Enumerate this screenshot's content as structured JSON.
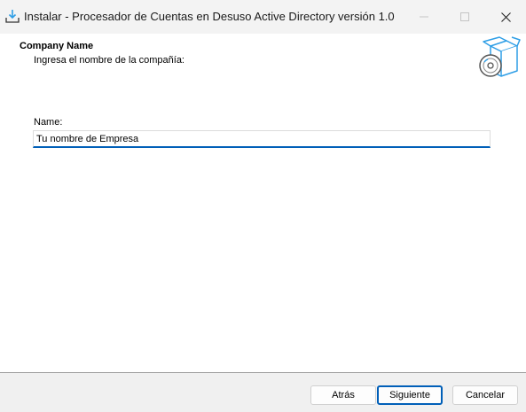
{
  "window": {
    "title": "Instalar - Procesador de Cuentas en Desuso Active Directory versión 1.0",
    "icons": {
      "app": "install-download-icon",
      "minimize": "minimize-icon",
      "maximize": "maximize-icon",
      "close": "close-icon"
    }
  },
  "header": {
    "title": "Company Name",
    "subtitle": "Ingresa el nombre de la compañía:",
    "image": "package-box-disc-icon"
  },
  "form": {
    "name_label": "Name:",
    "name_value": "Tu nombre de Empresa"
  },
  "buttons": {
    "back": "Atrás",
    "next": "Siguiente",
    "cancel": "Cancelar"
  },
  "colors": {
    "accent": "#005fb8",
    "titlebar": "#f3f3f3",
    "bottom_bar": "#f0f0f0",
    "icon_blue": "#2e9ee6"
  }
}
